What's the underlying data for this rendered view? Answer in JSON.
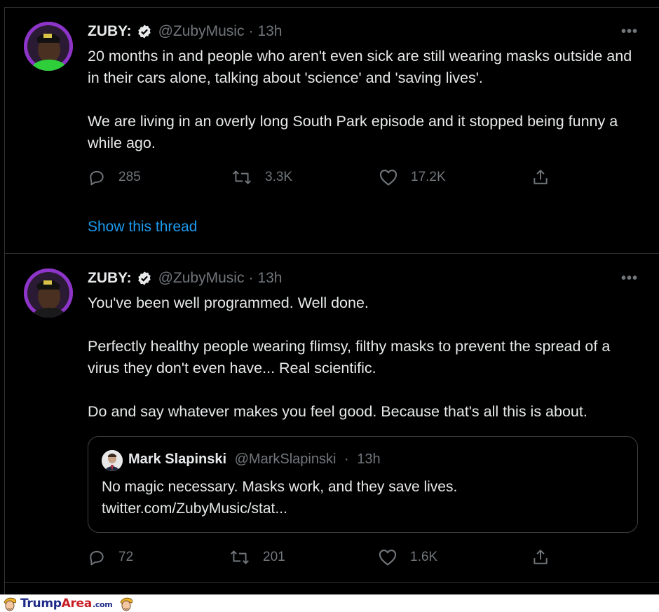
{
  "tweets": [
    {
      "name": "ZUBY:",
      "handle": "@ZubyMusic",
      "separator": "·",
      "time": "13h",
      "more": "•••",
      "paragraphs": [
        "20 months in and people who aren't even sick are still wearing masks outside and in their cars alone, talking about 'science' and 'saving lives'.",
        "We are living in an overly long South Park episode and it stopped being funny a while ago."
      ],
      "replies": "285",
      "retweets": "3.3K",
      "likes": "17.2K",
      "show_thread": "Show this thread"
    },
    {
      "name": "ZUBY:",
      "handle": "@ZubyMusic",
      "separator": "·",
      "time": "13h",
      "more": "•••",
      "paragraphs": [
        "You've been well programmed. Well done.",
        "Perfectly healthy people wearing flimsy, filthy masks to prevent the spread of a virus they don't even have... Real scientific.",
        "Do and say whatever makes you feel good. Because that's all this is about."
      ],
      "quote": {
        "name": "Mark Slapinski",
        "handle": "@MarkSlapinski",
        "separator": "·",
        "time": "13h",
        "line1": "No magic necessary. Masks work, and they save lives.",
        "line2": "twitter.com/ZubyMusic/stat..."
      },
      "replies": "72",
      "retweets": "201",
      "likes": "1.6K"
    }
  ],
  "watermark": {
    "trump": "Trump",
    "area": "Area",
    "com": ".com"
  },
  "colors": {
    "background": "#000000",
    "text": "#e7e9ea",
    "muted": "#71767b",
    "link": "#1d9bf0",
    "avatar_bg": "#8e35c9"
  }
}
